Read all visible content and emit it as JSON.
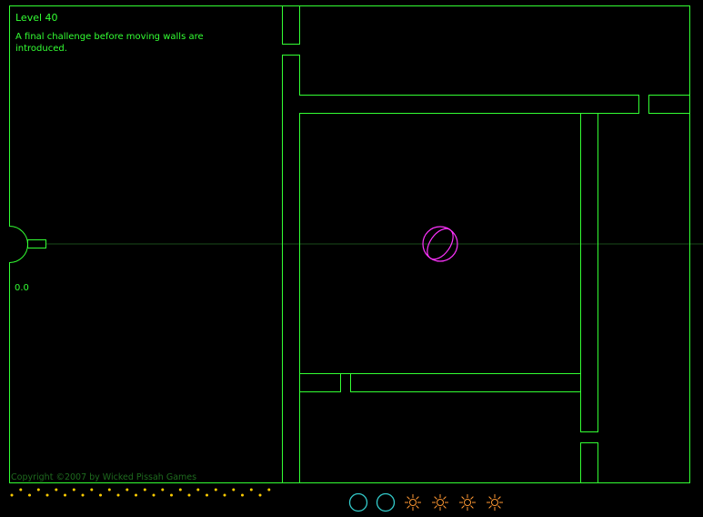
{
  "hud": {
    "level_title": "Level 40",
    "level_description": "A final challenge before moving walls are introduced.",
    "shot_power": "0.0",
    "copyright": "Copyright ©2007 by Wicked Pissah Games"
  },
  "colors": {
    "background": "#000000",
    "walls": "#33ff33",
    "aim_line": "#1a4d1a",
    "target": "#ff33ff",
    "shots_remaining": "#ffcc00",
    "balls_remaining": "#33cccc",
    "bursts": "#ff9933"
  },
  "icons": {
    "launcher": "launcher-icon",
    "target": "target-orb-icon",
    "balls": "ball-ring-icon",
    "bursts": "burst-icon"
  },
  "status_bar": {
    "shots_remaining": 30,
    "balls_remaining": 2,
    "bursts_remaining": 4
  }
}
